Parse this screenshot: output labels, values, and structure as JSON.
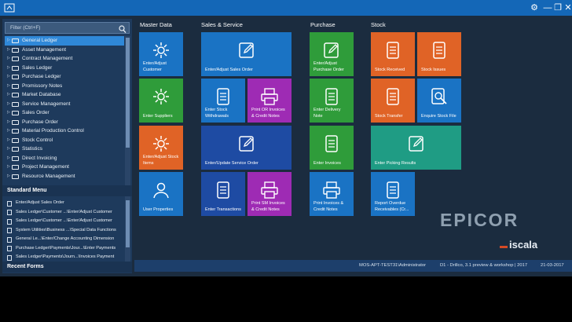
{
  "window": {
    "minimize_glyph": "—",
    "restore_glyph": "❐",
    "close_glyph": "✕",
    "settings_glyph": "⚙"
  },
  "sidebar": {
    "filter_placeholder": "Filter (Ctrl+F)",
    "tree_items": [
      {
        "label": "General Ledger",
        "selected": true
      },
      {
        "label": "Asset Management"
      },
      {
        "label": "Contract Management"
      },
      {
        "label": "Sales Ledger"
      },
      {
        "label": "Purchase Ledger"
      },
      {
        "label": "Promissory Notes"
      },
      {
        "label": "Market Database"
      },
      {
        "label": "Service Management"
      },
      {
        "label": "Sales Order"
      },
      {
        "label": "Purchase Order"
      },
      {
        "label": "Material Production Control"
      },
      {
        "label": "Stock Control"
      },
      {
        "label": "Statistics"
      },
      {
        "label": "Direct Invoicing"
      },
      {
        "label": "Project Management"
      },
      {
        "label": "Resource Management"
      }
    ],
    "standard_menu_title": "Standard Menu",
    "standard_menu_items": [
      "Enter/Adjust Sales Order",
      "Sales Ledger\\Customer ...\\Enter/Adjust Customer",
      "Sales Ledger\\Customer ...\\Enter/Adjust Customer",
      "System Utilities\\Business ...\\Special Data Functions",
      "General Le...\\Enter/Change Accounting Dimension",
      "Purchase Ledger\\Payments\\Jour...\\Enter Payments",
      "Sales Ledger\\Payments\\Journ...\\Invoices Payment"
    ],
    "recent_forms_title": "Recent Forms"
  },
  "columns": {
    "master_data": "Master Data",
    "sales_service": "Sales & Service",
    "purchase": "Purchase",
    "stock": "Stock"
  },
  "tiles": {
    "enter_adjust_customer": "Enter/Adjust Customer",
    "enter_suppliers": "Enter Suppliers",
    "enter_adjust_stock_items": "Enter/Adjust Stock Items",
    "user_properties": "User Properties",
    "enter_adjust_sales_order": "Enter/Adjust Sales Order",
    "enter_stock_withdrawals": "Enter Stock Withdrawals",
    "print_or_invoices": "Print OR Invoices & Credit Notes",
    "enter_update_service_order": "Enter/Update Service Order",
    "enter_transactions": "Enter Transactions",
    "print_sm_invoices": "Print SM Invoices & Credit Notes",
    "enter_adjust_purchase_order": "Enter/Adjust Purchase Order",
    "enter_delivery_note": "Enter Delivery Note",
    "enter_invoices": "Enter Invoices",
    "print_invoices_credit_notes": "Print Invoices & Credit Notes",
    "stock_received": "Stock Received",
    "stock_issues": "Stock Issues",
    "stock_transfer": "Stock Transfer",
    "enquire_stock_file": "Enquire Stock File",
    "enter_picking_results": "Enter Picking Results",
    "report_overdue_receivables": "Report Overdue Receivables (Cr..."
  },
  "statusbar": {
    "user": "MOS-APT-TEST31\\Administrator",
    "company": "D1 - Drillco, 3.1 preview & workshop | 2017",
    "date": "21-03-2017"
  },
  "logo": {
    "brand": "EPICOR",
    "product": "iscala"
  },
  "colors": {
    "titlebar": "#1467b7",
    "background": "#1b2c3f",
    "tile_blue": "#1a73c4",
    "tile_green": "#2f9c3a",
    "tile_orange": "#e06326",
    "tile_purple": "#9e2bb4",
    "tile_teal": "#1f9c84"
  }
}
